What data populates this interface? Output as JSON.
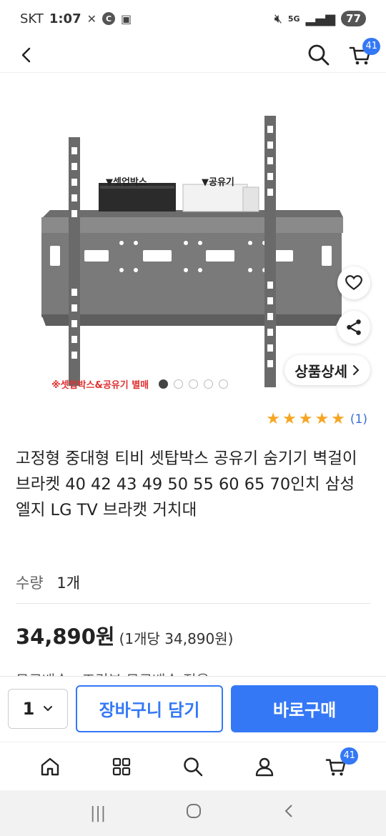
{
  "status_bar": {
    "carrier": "SKT",
    "time": "1:07",
    "c_icon": "C",
    "network": "5G",
    "battery": "77"
  },
  "header": {
    "cart_count": "41"
  },
  "gallery": {
    "label_settop": "▼셋업박스",
    "label_router": "▼공유기",
    "caption": "※셋업박스&공유기 별매",
    "detail_button": "상품상세",
    "slide_count": 5,
    "active_slide": 1
  },
  "rating": {
    "stars": 5,
    "count": "(1)"
  },
  "product": {
    "title": "고정형 중대형 티비 셋탑박스 공유기 숨기기 벽걸이 브라켓 40 42 43 49 50 55 60 65 70인치 삼성 엘지 LG TV 브라캣 거치대",
    "quantity_label": "수량",
    "quantity_value": "1개",
    "price": "34,890원",
    "unit_price": "(1개당 34,890원)",
    "cutoff_text": "무료배송 · 조건부 무료배송 적용"
  },
  "actions": {
    "quantity": "1",
    "add_to_cart": "장바구니 담기",
    "buy_now": "바로구매"
  },
  "bottom_nav": {
    "cart_count": "41"
  },
  "colors": {
    "accent": "#3478f6",
    "star": "#f5a623",
    "caption_red": "#e03030"
  }
}
